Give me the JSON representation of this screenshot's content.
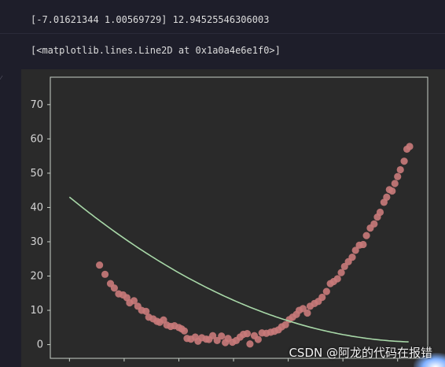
{
  "outputs": {
    "line1": "[-7.01621344  1.00569729] 12.94525546306003",
    "line2": "[<matplotlib.lines.Line2D at 0x1a0a4e6e1f0>]"
  },
  "watermark": "CSDN @阿龙的代码在报错",
  "colors": {
    "background": "#1e1e2a",
    "plot_background": "#2a2a2a",
    "frame": "#c8d0c8",
    "scatter": "#c97a7a",
    "fit_line": "#a8d8a8"
  },
  "chart_data": {
    "type": "scatter",
    "xlim": [
      -3.35,
      3.55
    ],
    "ylim": [
      -4,
      78
    ],
    "ytick_labels": [
      "0",
      "10",
      "20",
      "30",
      "40",
      "50",
      "60",
      "70"
    ],
    "ytick_values": [
      0,
      10,
      20,
      30,
      40,
      50,
      60,
      70
    ],
    "grid": false,
    "series": [
      {
        "kind": "scatter",
        "color": "#c97a7a",
        "points": [
          [
            -2.45,
            23.2
          ],
          [
            -2.35,
            20.5
          ],
          [
            -2.25,
            17.8
          ],
          [
            -2.18,
            16.5
          ],
          [
            -2.1,
            14.8
          ],
          [
            -2.02,
            14.5
          ],
          [
            -1.95,
            13.7
          ],
          [
            -1.9,
            12.2
          ],
          [
            -1.82,
            12.8
          ],
          [
            -1.75,
            11.2
          ],
          [
            -1.68,
            10.0
          ],
          [
            -1.6,
            9.7
          ],
          [
            -1.55,
            8.0
          ],
          [
            -1.47,
            7.5
          ],
          [
            -1.4,
            6.8
          ],
          [
            -1.35,
            6.5
          ],
          [
            -1.28,
            7.2
          ],
          [
            -1.22,
            5.7
          ],
          [
            -1.15,
            5.3
          ],
          [
            -1.08,
            5.5
          ],
          [
            -1.0,
            5.0
          ],
          [
            -0.95,
            4.6
          ],
          [
            -0.9,
            4.0
          ],
          [
            -0.85,
            1.8
          ],
          [
            -0.78,
            1.6
          ],
          [
            -0.7,
            2.2
          ],
          [
            -0.65,
            1.0
          ],
          [
            -0.58,
            2.0
          ],
          [
            -0.5,
            1.6
          ],
          [
            -0.45,
            1.5
          ],
          [
            -0.38,
            2.6
          ],
          [
            -0.3,
            1.2
          ],
          [
            -0.22,
            2.5
          ],
          [
            -0.15,
            0.6
          ],
          [
            -0.1,
            1.8
          ],
          [
            -0.02,
            0.7
          ],
          [
            0.05,
            1.2
          ],
          [
            0.12,
            2.2
          ],
          [
            0.18,
            3.0
          ],
          [
            0.25,
            3.2
          ],
          [
            0.3,
            0.2
          ],
          [
            0.38,
            2.6
          ],
          [
            0.45,
            1.5
          ],
          [
            0.52,
            3.4
          ],
          [
            0.6,
            3.3
          ],
          [
            0.68,
            3.6
          ],
          [
            0.75,
            3.9
          ],
          [
            0.82,
            4.3
          ],
          [
            0.88,
            5.2
          ],
          [
            0.95,
            5.8
          ],
          [
            1.02,
            7.3
          ],
          [
            1.08,
            8.0
          ],
          [
            1.15,
            8.8
          ],
          [
            1.2,
            10.0
          ],
          [
            1.27,
            10.5
          ],
          [
            1.35,
            9.2
          ],
          [
            1.4,
            11.2
          ],
          [
            1.48,
            12.0
          ],
          [
            1.55,
            12.6
          ],
          [
            1.62,
            13.8
          ],
          [
            1.7,
            15.5
          ],
          [
            1.77,
            17.8
          ],
          [
            1.83,
            18.4
          ],
          [
            1.9,
            19.2
          ],
          [
            1.97,
            21.0
          ],
          [
            2.03,
            22.8
          ],
          [
            2.1,
            24.2
          ],
          [
            2.17,
            25.5
          ],
          [
            2.23,
            27.5
          ],
          [
            2.3,
            29.0
          ],
          [
            2.37,
            29.2
          ],
          [
            2.43,
            31.8
          ],
          [
            2.5,
            34.0
          ],
          [
            2.57,
            35.2
          ],
          [
            2.63,
            37.2
          ],
          [
            2.68,
            38.6
          ],
          [
            2.75,
            41.5
          ],
          [
            2.8,
            43.0
          ],
          [
            2.85,
            45.2
          ],
          [
            2.9,
            44.8
          ],
          [
            2.95,
            47.0
          ],
          [
            3.0,
            49.0
          ],
          [
            3.05,
            51.0
          ],
          [
            3.12,
            53.5
          ],
          [
            3.17,
            57.0
          ],
          [
            3.22,
            57.8
          ]
        ]
      },
      {
        "kind": "line",
        "color": "#a8d8a8",
        "coefficients": [
          12.94525546306003,
          -7.01621344,
          1.00569729
        ],
        "x_range": [
          -3.0,
          3.2
        ]
      }
    ]
  }
}
